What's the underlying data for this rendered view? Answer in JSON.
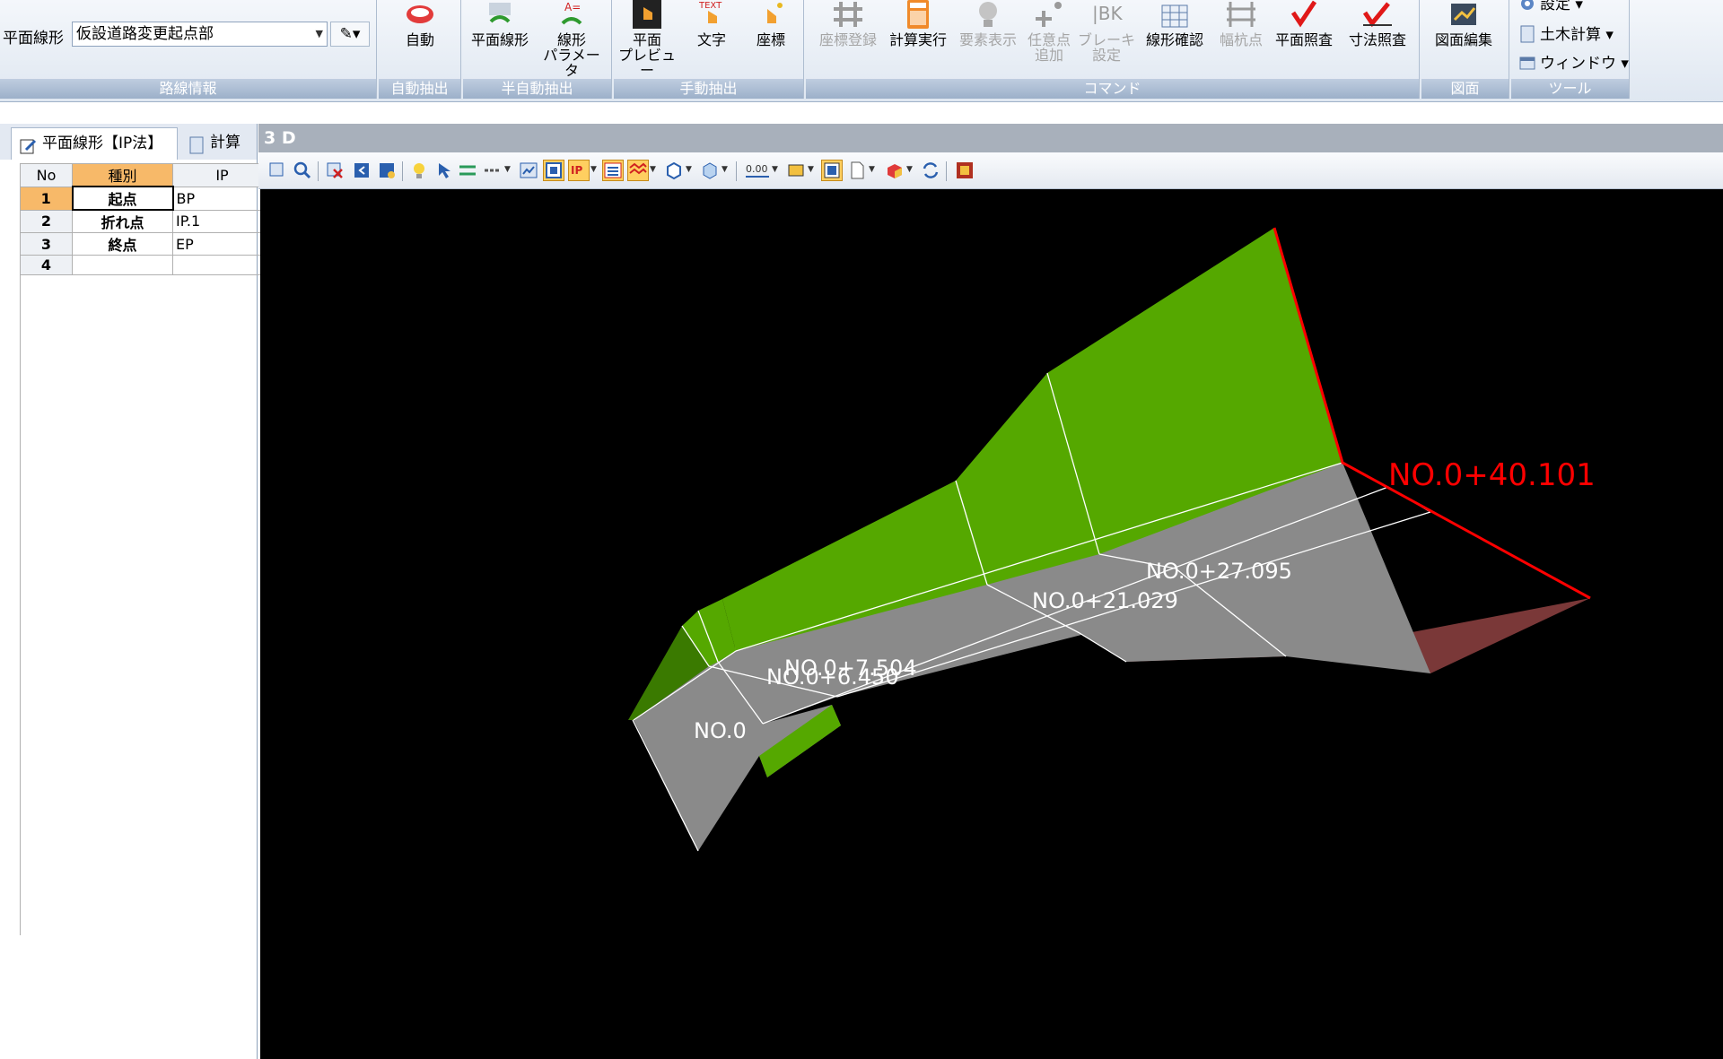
{
  "ribbon": {
    "route_label": "平面線形",
    "route_value": "仮設道路変更起点部",
    "groups": {
      "route_info": "路線情報",
      "auto_extract": "自動抽出",
      "semi_auto": "半自動抽出",
      "manual": "手動抽出",
      "command": "コマンド",
      "drawing": "図面",
      "tool": "ツール"
    },
    "buttons": {
      "auto": "自動",
      "plane_alignment": "平面線形",
      "alignment_params": "線形\nパラメータ",
      "plane_preview": "平面\nプレビュー",
      "text": "文字",
      "coord": "座標",
      "coord_register": "座標登録",
      "calc_run": "計算実行",
      "element_display": "要素表示",
      "add_point": "任意点\n追加",
      "break_setting": "ブレーキ\n設定",
      "alignment_check": "線形確認",
      "width_pile": "幅杭点",
      "plane_check": "平面照査",
      "dimension_check": "寸法照査",
      "drawing_edit": "図面編集"
    },
    "tools": {
      "settings": "設定",
      "civil_calc": "土木計算",
      "window": "ウィンドウ"
    },
    "text_icon_caption": "TEXT"
  },
  "left_panel": {
    "tabs": [
      "平面線形【IP法】",
      "計算"
    ],
    "columns": [
      "No",
      "種別",
      "IP"
    ],
    "rows": [
      {
        "no": "1",
        "kind": "起点",
        "ip": "BP"
      },
      {
        "no": "2",
        "kind": "折れ点",
        "ip": "IP.1"
      },
      {
        "no": "3",
        "kind": "終点",
        "ip": "EP"
      },
      {
        "no": "4",
        "kind": "",
        "ip": ""
      }
    ]
  },
  "view": {
    "title": "3 D",
    "stations": {
      "s0": "NO.0",
      "s1": "NO.0+6.450",
      "s2": "NO.0+7.504",
      "s3": "NO.0+21.029",
      "s4": "NO.0+27.095",
      "s5": "NO.0+40.101"
    },
    "colors": {
      "slope": "#55a800",
      "slope_dark": "#3a7a00",
      "road": "#8a8a8a",
      "fill": "#7a3838",
      "edge": "#ff0000",
      "background": "#000000",
      "highlight": "#f7b969"
    }
  }
}
